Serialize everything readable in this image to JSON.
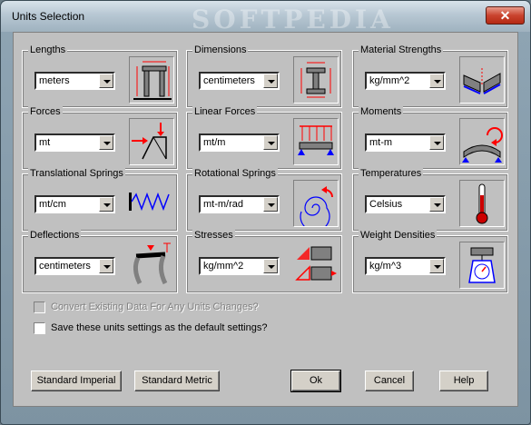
{
  "window": {
    "title": "Units Selection",
    "watermark": "SOFTPEDIA",
    "close_label": "✕"
  },
  "groups": [
    {
      "label": "Lengths",
      "value": "meters",
      "icon": "frame-lengths-icon"
    },
    {
      "label": "Dimensions",
      "value": "centimeters",
      "icon": "i-beam-dimensions-icon"
    },
    {
      "label": "Material Strengths",
      "value": "kg/mm^2",
      "icon": "material-strength-icon"
    },
    {
      "label": "Forces",
      "value": "mt",
      "icon": "truss-forces-icon"
    },
    {
      "label": "Linear Forces",
      "value": "mt/m",
      "icon": "distributed-load-icon"
    },
    {
      "label": "Moments",
      "value": "mt-m",
      "icon": "bending-moment-icon"
    },
    {
      "label": "Translational Springs",
      "value": "mt/cm",
      "icon": "spring-icon"
    },
    {
      "label": "Rotational Springs",
      "value": "mt-m/rad",
      "icon": "rotational-spring-icon"
    },
    {
      "label": "Temperatures",
      "value": "Celsius",
      "icon": "thermometer-icon"
    },
    {
      "label": "Deflections",
      "value": "centimeters",
      "icon": "deflected-frame-icon"
    },
    {
      "label": "Stresses",
      "value": "kg/mm^2",
      "icon": "stress-element-icon"
    },
    {
      "label": "Weight Densities",
      "value": "kg/m^3",
      "icon": "scale-icon"
    }
  ],
  "options": {
    "convert_label": "Convert Existing Data For Any Units Changes?",
    "save_default_label": "Save these units settings as the default settings?"
  },
  "buttons": {
    "imperial": "Standard Imperial",
    "metric": "Standard Metric",
    "ok": "Ok",
    "cancel": "Cancel",
    "help": "Help"
  },
  "colors": {
    "accent_red": "#ff0000",
    "accent_blue": "#0000ff",
    "dialog_gray": "#c0c0c0"
  }
}
